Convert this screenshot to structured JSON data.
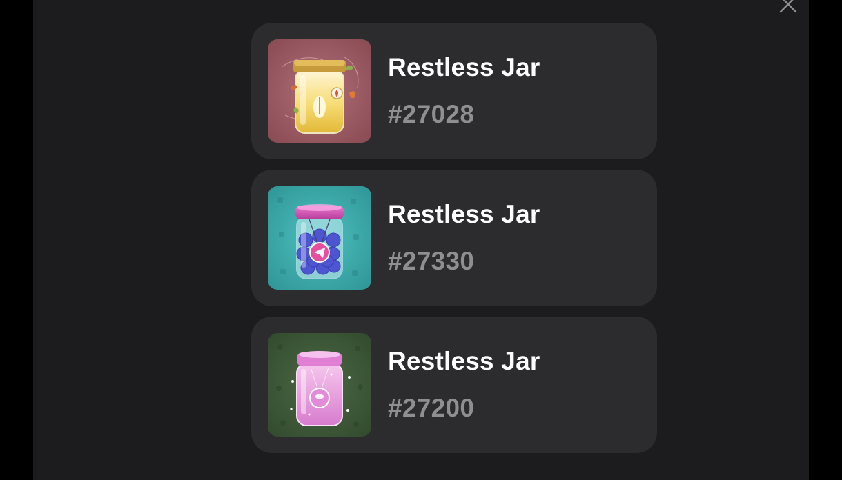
{
  "dialog": {
    "close_icon": "close-icon",
    "items": [
      {
        "name": "Restless Jar",
        "number": "#27028",
        "icon": "candle-jar-icon",
        "bg": "#9b5a62",
        "accent": "#f4d27a"
      },
      {
        "name": "Restless Jar",
        "number": "#27330",
        "icon": "berry-jar-icon",
        "bg": "#3aa7a8",
        "accent": "#5b62d6"
      },
      {
        "name": "Restless Jar",
        "number": "#27200",
        "icon": "sparkle-jar-icon",
        "bg": "#3f5a39",
        "accent": "#e79ad8"
      }
    ]
  }
}
